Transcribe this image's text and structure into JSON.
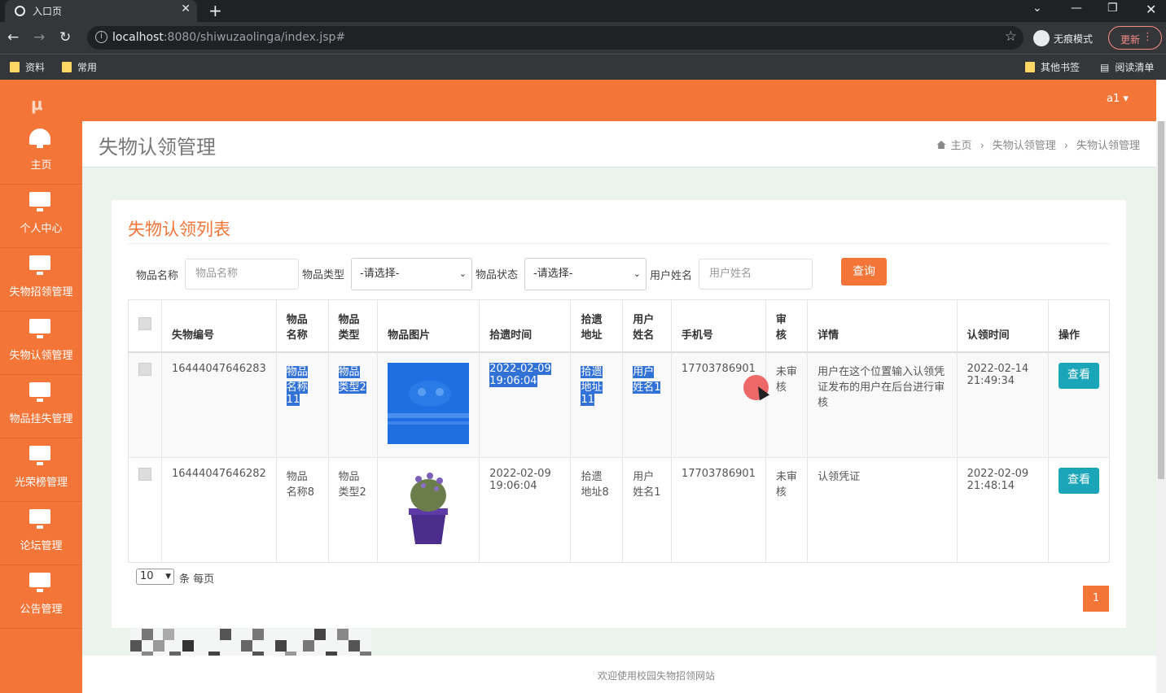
{
  "browser": {
    "tab_title": "入口页",
    "url_host": "localhost",
    "url_rest": ":8080/shiwuzaolinga/index.jsp#",
    "incognito_label": "无痕模式",
    "update_label": "更新",
    "bookmarks": [
      "资料",
      "常用"
    ],
    "bookmarks_right": [
      "其他书签",
      "阅读清单"
    ]
  },
  "header": {
    "logo": "μ",
    "user": "a1 ▾"
  },
  "sidebar": {
    "items": [
      {
        "label": "主页",
        "icon": "dashboard-icon"
      },
      {
        "label": "个人中心",
        "icon": "monitor-icon"
      },
      {
        "label": "失物招领管理",
        "icon": "monitor-icon"
      },
      {
        "label": "失物认领管理",
        "icon": "monitor-icon"
      },
      {
        "label": "物品挂失管理",
        "icon": "monitor-icon"
      },
      {
        "label": "光荣榜管理",
        "icon": "monitor-icon"
      },
      {
        "label": "论坛管理",
        "icon": "monitor-icon"
      },
      {
        "label": "公告管理",
        "icon": "monitor-icon"
      }
    ]
  },
  "page": {
    "title": "失物认领管理",
    "breadcrumb": [
      "主页",
      "失物认领管理",
      "失物认领管理"
    ]
  },
  "panel": {
    "title": "失物认领列表",
    "filters": {
      "name_label": "物品名称",
      "name_placeholder": "物品名称",
      "type_label": "物品类型",
      "type_value": "-请选择-",
      "status_label": "物品状态",
      "status_value": "-请选择-",
      "user_label": "用户姓名",
      "user_placeholder": "用户姓名",
      "query_label": "查询"
    },
    "table": {
      "headers": [
        "失物编号",
        "物品\n名称",
        "物品\n类型",
        "物品图片",
        "拾遗时间",
        "拾遗\n地址",
        "用户\n姓名",
        "手机号",
        "审\n核",
        "详情",
        "认领时间",
        "操作"
      ],
      "rows": [
        {
          "id": "16444047646283",
          "name": "物品名称11",
          "type": "物品类型2",
          "image": "blue-image",
          "time": "2022-02-09 19:06:04",
          "addr": "拾遗地址11",
          "user": "用户姓名1",
          "phone": "17703786901",
          "audit": "未审核",
          "detail": "用户在这个位置输入认领凭证发布的用户在后台进行审核",
          "claim_time": "2022-02-14 21:49:34",
          "action": "查看"
        },
        {
          "id": "16444047646282",
          "name": "物品名称8",
          "type": "物品类型2",
          "image": "lavender-pot-image",
          "time": "2022-02-09 19:06:04",
          "addr": "拾遗地址8",
          "user": "用户姓名1",
          "phone": "17703786901",
          "audit": "未审核",
          "detail": "认领凭证",
          "claim_time": "2022-02-09 21:48:14",
          "action": "查看"
        }
      ]
    },
    "pagination": {
      "page_size": "10",
      "per_page_label": "条 每页",
      "current_page": "1"
    }
  },
  "footer": {
    "text": "欢迎使用校园失物招领网站"
  }
}
